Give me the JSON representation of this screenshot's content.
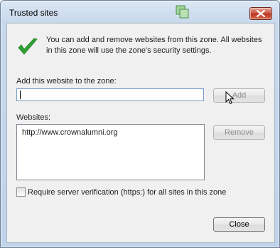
{
  "window": {
    "title": "Trusted sites"
  },
  "intro_text": "You can add and remove websites from this zone. All websites in this zone will use the zone's security settings.",
  "add_section": {
    "label": "Add this website to the zone:",
    "input_value": "",
    "add_label": "Add"
  },
  "websites": {
    "label": "Websites:",
    "items": [
      "http://www.crownalumni.org"
    ],
    "remove_label": "Remove"
  },
  "https": {
    "label": "Require server verification (https:) for all sites in this zone",
    "checked": false
  },
  "footer": {
    "close_label": "Close"
  },
  "colors": {
    "check_green": "#2fa234",
    "close_red": "#c7503b"
  },
  "icons": [
    "zone-icon",
    "close-icon",
    "checkmark-icon",
    "mouse-cursor-icon"
  ]
}
